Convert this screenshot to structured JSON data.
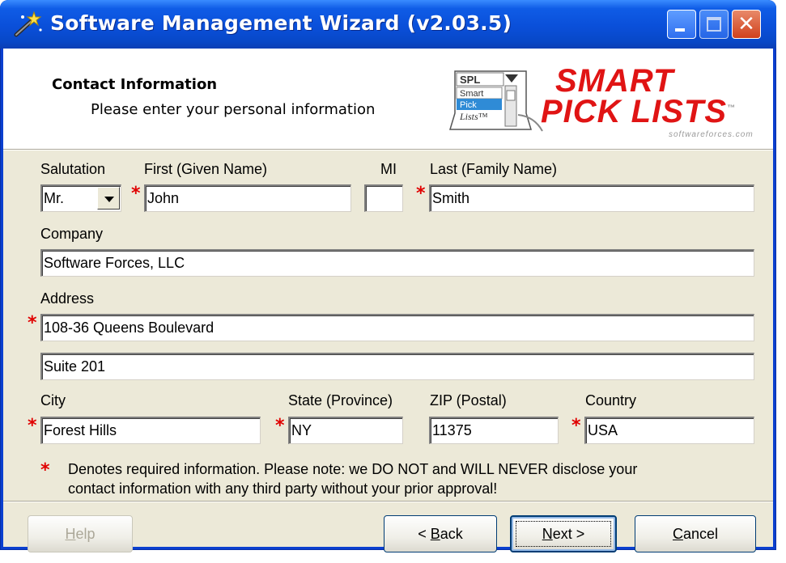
{
  "window": {
    "title": "Software Management Wizard (v2.03.5)"
  },
  "header": {
    "title": "Contact Information",
    "subtitle": "Please enter your personal information",
    "logo": {
      "line1": "SMART",
      "line2": "PICK LISTS",
      "tm": "™",
      "url": "softwareforces.com"
    },
    "spl_icon": {
      "top": "SPL",
      "items": [
        "Smart",
        "Pick",
        "Lists™"
      ]
    }
  },
  "form": {
    "salutation": {
      "label": "Salutation",
      "value": "Mr."
    },
    "first": {
      "label": "First (Given Name)",
      "value": "John"
    },
    "mi": {
      "label": "MI",
      "value": ""
    },
    "last": {
      "label": "Last (Family Name)",
      "value": "Smith"
    },
    "company": {
      "label": "Company",
      "value": "Software Forces, LLC"
    },
    "address": {
      "label": "Address",
      "line1": "108-36 Queens Boulevard",
      "line2": "Suite 201"
    },
    "city": {
      "label": "City",
      "value": "Forest Hills"
    },
    "state": {
      "label": "State (Province)",
      "value": "NY"
    },
    "zip": {
      "label": "ZIP (Postal)",
      "value": "11375"
    },
    "country": {
      "label": "Country",
      "value": "USA"
    },
    "required_mark": "*",
    "note_line1": "Denotes required information. Please note: we DO NOT and WILL NEVER disclose your",
    "note_line2": "contact information with any third party without your prior approval!"
  },
  "buttons": {
    "help": {
      "prefix": "",
      "hotkey": "H",
      "rest": "elp"
    },
    "back": {
      "prefix": "< ",
      "hotkey": "B",
      "rest": "ack"
    },
    "next": {
      "prefix": "",
      "hotkey": "N",
      "rest": "ext >"
    },
    "cancel": {
      "prefix": "",
      "hotkey": "C",
      "rest": "ancel"
    }
  },
  "colors": {
    "titlebar": "#0a4fd9",
    "dialog_bg": "#ece9d8",
    "required": "#e00000",
    "logo": "#e01414"
  }
}
